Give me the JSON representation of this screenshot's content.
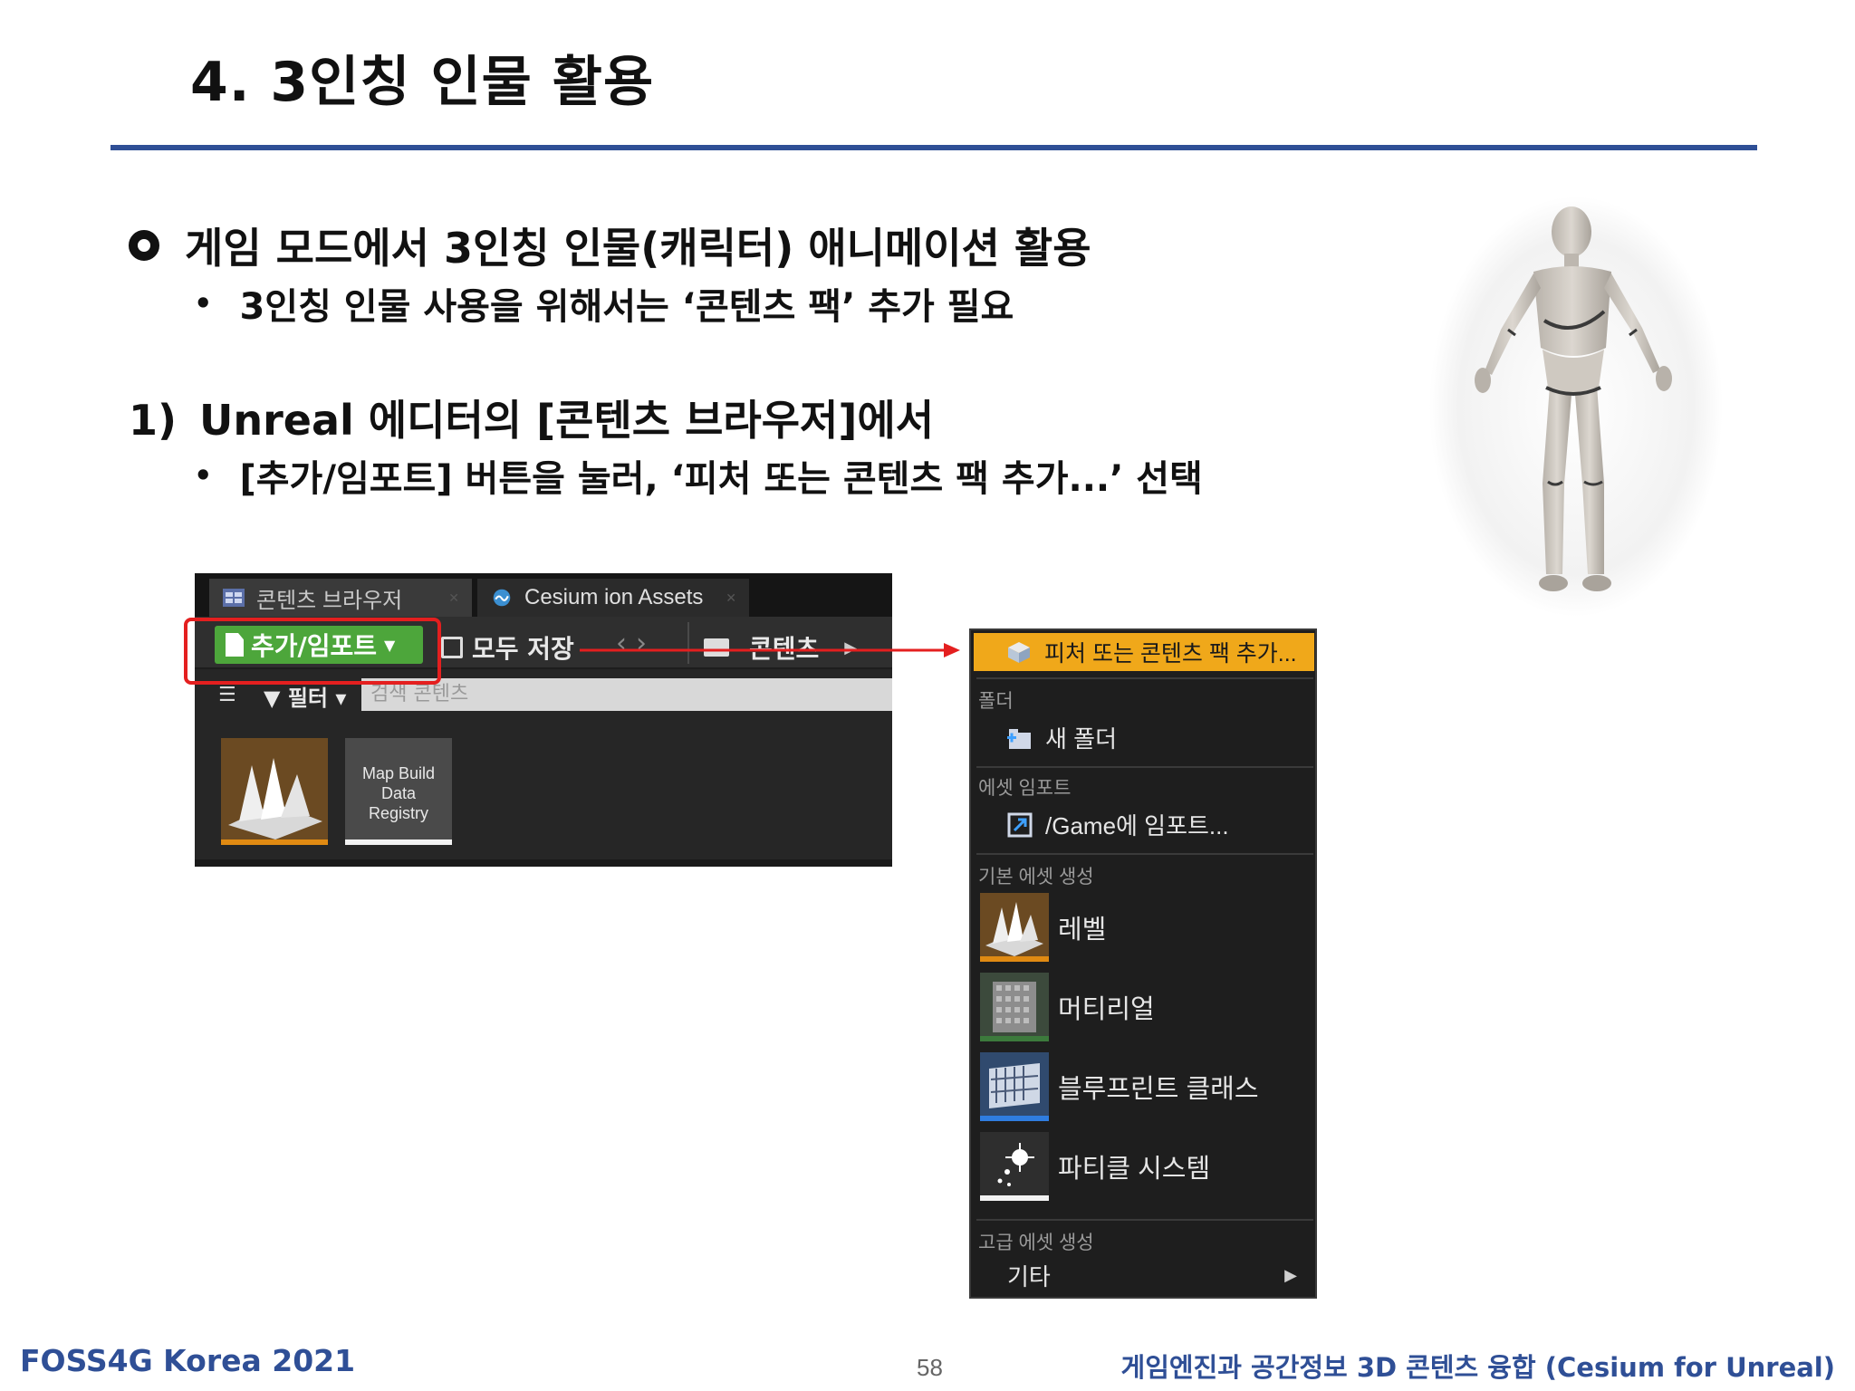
{
  "slide": {
    "title": "4. 3인칭 인물 활용",
    "bullet_main": "게임 모드에서 3인칭 인물(캐릭터) 애니메이션 활용",
    "bullet_sub1": "3인칭 인물 사용을 위해서는 ‘콘텐츠 팩’ 추가 필요",
    "step1_number": "1)",
    "step1_text": "Unreal 에디터의 [콘텐츠 브라우저]에서",
    "bullet_sub2": "[추가/임포트] 버튼을 눌러, ‘피처 또는 콘텐츠 팩 추가...’ 선택"
  },
  "content_browser": {
    "tabs": [
      {
        "label": "콘텐츠 브라우저",
        "icon": "content-browser-icon"
      },
      {
        "label": "Cesium ion Assets",
        "icon": "cesium-icon"
      }
    ],
    "add_import_label": "추가/임포트",
    "save_all_label": "모두 저장",
    "breadcrumb_label": "콘텐츠",
    "filter_label": "필터",
    "search_placeholder": "검색 콘텐츠",
    "assets": [
      {
        "label": "",
        "type": "level",
        "accent": "#e08a12"
      },
      {
        "label_lines": [
          "Map Build",
          "Data",
          "Registry"
        ],
        "accent": "#f2f2f2"
      }
    ]
  },
  "add_menu": {
    "top_item": "피처 또는 콘텐츠 팩 추가...",
    "sections": [
      {
        "header": "폴더",
        "items": [
          "새 폴더"
        ]
      },
      {
        "header": "에셋 임포트",
        "items": [
          "/Game에 임포트..."
        ]
      },
      {
        "header": "기본 에셋 생성",
        "items": [
          "레벨",
          "머티리얼",
          "블루프린트 클래스",
          "파티클 시스템"
        ]
      },
      {
        "header": "고급 에셋 생성",
        "items": [
          "기타"
        ]
      }
    ]
  },
  "footer": {
    "left": "FOSS4G Korea 2021",
    "page": "58",
    "right": "게임엔진과 공간정보 3D 콘텐츠 융합 (Cesium for Unreal)"
  },
  "colors": {
    "accent_blue": "#2f4f96",
    "highlight_red": "#e41f1f",
    "button_green": "#4da63b",
    "menu_orange": "#f0a81a"
  }
}
